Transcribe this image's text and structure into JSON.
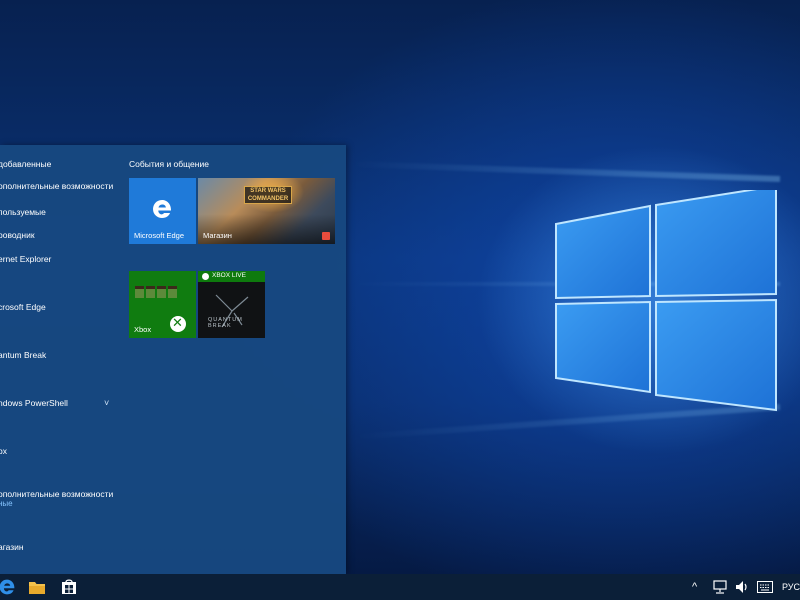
{
  "start_menu": {
    "app_list": [
      {
        "label": "добавленные"
      },
      {
        "label": "ополнительные возможности"
      },
      {
        "label": "пользуемые"
      },
      {
        "label": "роводник"
      },
      {
        "label": "ernet Explorer"
      },
      {
        "label": "crosoft Edge"
      },
      {
        "label": "antum Break"
      },
      {
        "label": "ndows PowerShell",
        "chevron": "˅"
      },
      {
        "label": "ox"
      },
      {
        "label": "ополнительные возможности",
        "sub": "ные"
      },
      {
        "label": "агазин"
      }
    ],
    "group_title": "События и общение",
    "tiles": {
      "edge": {
        "label": "Microsoft Edge",
        "icon": "edge-icon"
      },
      "store": {
        "label": "Магазин",
        "badge": "STAR WARS COMMANDER",
        "icon": "store-bag-icon"
      },
      "xbox": {
        "label": "Xbox",
        "icon": "xbox-icon"
      },
      "quantum": {
        "bar_text": "XBOX LIVE",
        "art_text": "QUANTUM BREAK"
      }
    }
  },
  "taskbar": {
    "icons": [
      "edge-icon",
      "file-explorer-icon",
      "store-icon"
    ],
    "tray": {
      "up_arrow": "^",
      "language": "РУС"
    }
  },
  "colors": {
    "start_bg": "#174880",
    "edge_tile": "#1f7ad9",
    "xbox_tile": "#107c10",
    "taskbar": "#0b1f38"
  }
}
